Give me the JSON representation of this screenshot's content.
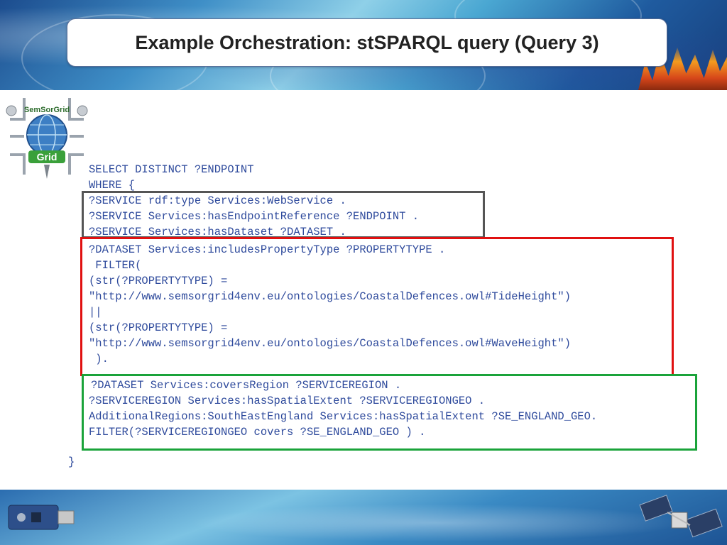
{
  "slide": {
    "title": "Example Orchestration: stSPARQL query (Query 3)"
  },
  "logo": {
    "text_top": "SemSorGrid",
    "text_banner": "Grid"
  },
  "query": {
    "line_select": "SELECT DISTINCT ?ENDPOINT",
    "line_where": "WHERE {",
    "line_1": "?SERVICE rdf:type Services:WebService .",
    "line_2": "?SERVICE Services:hasEndpointReference ?ENDPOINT .",
    "line_3": "?SERVICE Services:hasDataset ?DATASET .",
    "line_4": "?DATASET Services:includesPropertyType ?PROPERTYTYPE .",
    "line_5": " FILTER(",
    "line_6": "(str(?PROPERTYTYPE) =",
    "line_7": "\"http://www.semsorgrid4env.eu/ontologies/CoastalDefences.owl#TideHeight\")",
    "line_8": "||",
    "line_9": "(str(?PROPERTYTYPE) =",
    "line_10": "\"http://www.semsorgrid4env.eu/ontologies/CoastalDefences.owl#WaveHeight\")",
    "line_11": " ).",
    "line_12": "?DATASET Services:coversRegion ?SERVICEREGION .",
    "line_13": "?SERVICEREGION Services:hasSpatialExtent ?SERVICEREGIONGEO .",
    "line_14": "AdditionalRegions:SouthEastEngland Services:hasSpatialExtent ?SE_ENGLAND_GEO.",
    "line_15": "FILTER(?SERVICEREGIONGEO covers ?SE_ENGLAND_GEO ) .",
    "line_close": "}"
  },
  "colors": {
    "code_text": "#2e4a9c",
    "box_service": "#555555",
    "box_property": "#e01010",
    "box_region": "#1aa33a"
  }
}
